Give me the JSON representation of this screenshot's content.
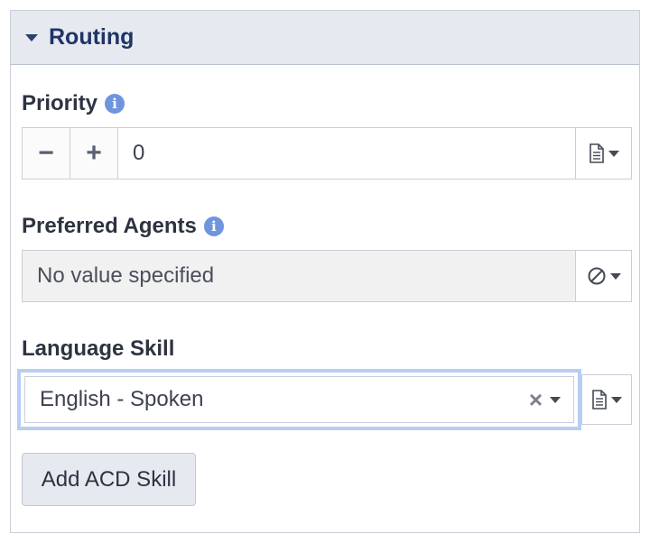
{
  "panel": {
    "title": "Routing"
  },
  "priority": {
    "label": "Priority",
    "decrement": "−",
    "increment": "+",
    "value": "0"
  },
  "preferred_agents": {
    "label": "Preferred Agents",
    "value": "No value specified"
  },
  "language_skill": {
    "label": "Language Skill",
    "value": "English - Spoken",
    "clear": "×"
  },
  "add_button": {
    "label": "Add ACD Skill"
  },
  "icons": {
    "info": "i"
  }
}
